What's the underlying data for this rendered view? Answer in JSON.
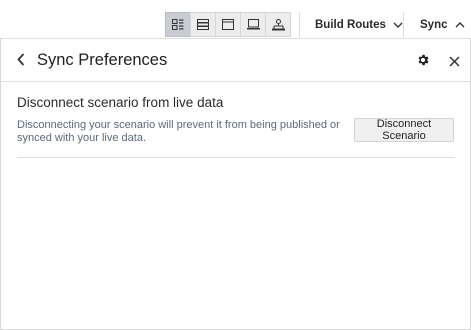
{
  "toolbar": {
    "view_buttons": [
      {
        "icon": "grid-view-icon",
        "active": true
      },
      {
        "icon": "list-view-icon",
        "active": false
      },
      {
        "icon": "window-view-icon",
        "active": false
      },
      {
        "icon": "laptop-view-icon",
        "active": false
      },
      {
        "icon": "network-view-icon",
        "active": false
      }
    ],
    "build_routes_label": "Build Routes",
    "sync_label": "Sync"
  },
  "panel": {
    "title": "Sync Preferences",
    "section": {
      "title": "Disconnect scenario from live data",
      "description": "Disconnecting your scenario will prevent it from being published or synced with your live data.",
      "button_label": "Disconnect Scenario"
    }
  }
}
